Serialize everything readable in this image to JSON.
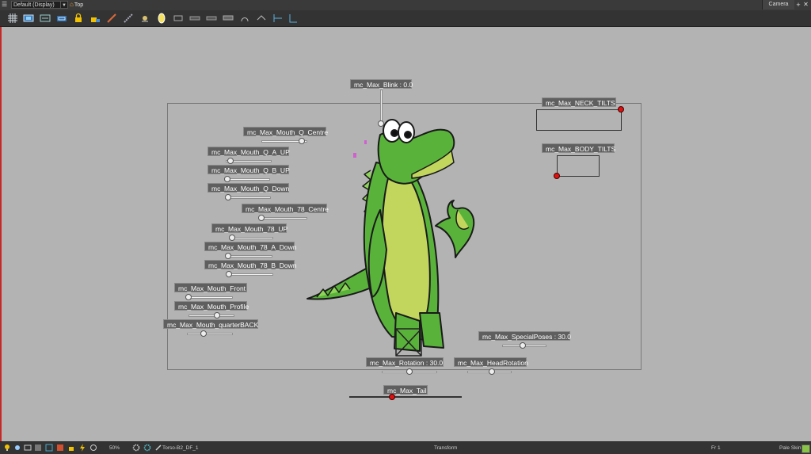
{
  "topbar": {
    "view_select": "Default (Display)",
    "breadcrumb": "Top",
    "camera_tab": "Camera",
    "add_tab": "+",
    "close_tab": "✕"
  },
  "toolbar": {
    "icons": [
      "grid-icon",
      "camera-mask-icon",
      "field-guide-icon",
      "safe-area-icon",
      "lock-icon",
      "lock-all-icon",
      "brush-icon",
      "ruler-icon",
      "onion-skin-icon",
      "light-table-icon",
      "peg-icon",
      "shape-1-icon",
      "shape-2-icon",
      "shape-3-icon",
      "shape-4-icon",
      "bone-icon",
      "deform-icon",
      "align-1-icon",
      "align-2-icon"
    ]
  },
  "controls": {
    "blink": "mc_Max_Blink : 0.0",
    "mouth_q_centre": "mc_Max_Mouth_Q_Centre",
    "mouth_q_a_up": "mc_Max_Mouth_Q_A_UP",
    "mouth_q_b_up": "mc_Max_Mouth_Q_B_UP",
    "mouth_q_down": "mc_Max_Mouth_Q_Down",
    "mouth_78_centre": "mc_Max_Mouth_78_Centre",
    "mouth_78_up": "mc_Max_Mouth_78_UP",
    "mouth_78_a_down": "mc_Max_Mouth_78_A_Down",
    "mouth_78_b_down": "mc_Max_Mouth_78_B_Down",
    "mouth_front": "mc_Max_Mouth_Front",
    "mouth_profile": "mc_Max_Mouth_Profile",
    "mouth_quarterback": "mc_Max_Mouth_quarterBACK",
    "neck_tilts": "mc_Max_NECK_TILTS",
    "body_tilts": "mc_Max_BODY_TILTS",
    "special_poses": "mc_Max_SpecialPoses : 30.0",
    "rotation": "mc_Max_Rotation : 30.0",
    "head_rotation": "mc_Max_HeadRotation",
    "tail": "mc_Max_Tail"
  },
  "statusbar": {
    "zoom": "50%",
    "layer": "Torso-B2_DF_1",
    "tool": "Transform",
    "frame": "Fr 1",
    "skin": "Pale Skin"
  },
  "colors": {
    "croc_green": "#59b33a",
    "croc_belly": "#c2d65e",
    "knob_red": "#e01010",
    "background": "#b3b3b3"
  }
}
